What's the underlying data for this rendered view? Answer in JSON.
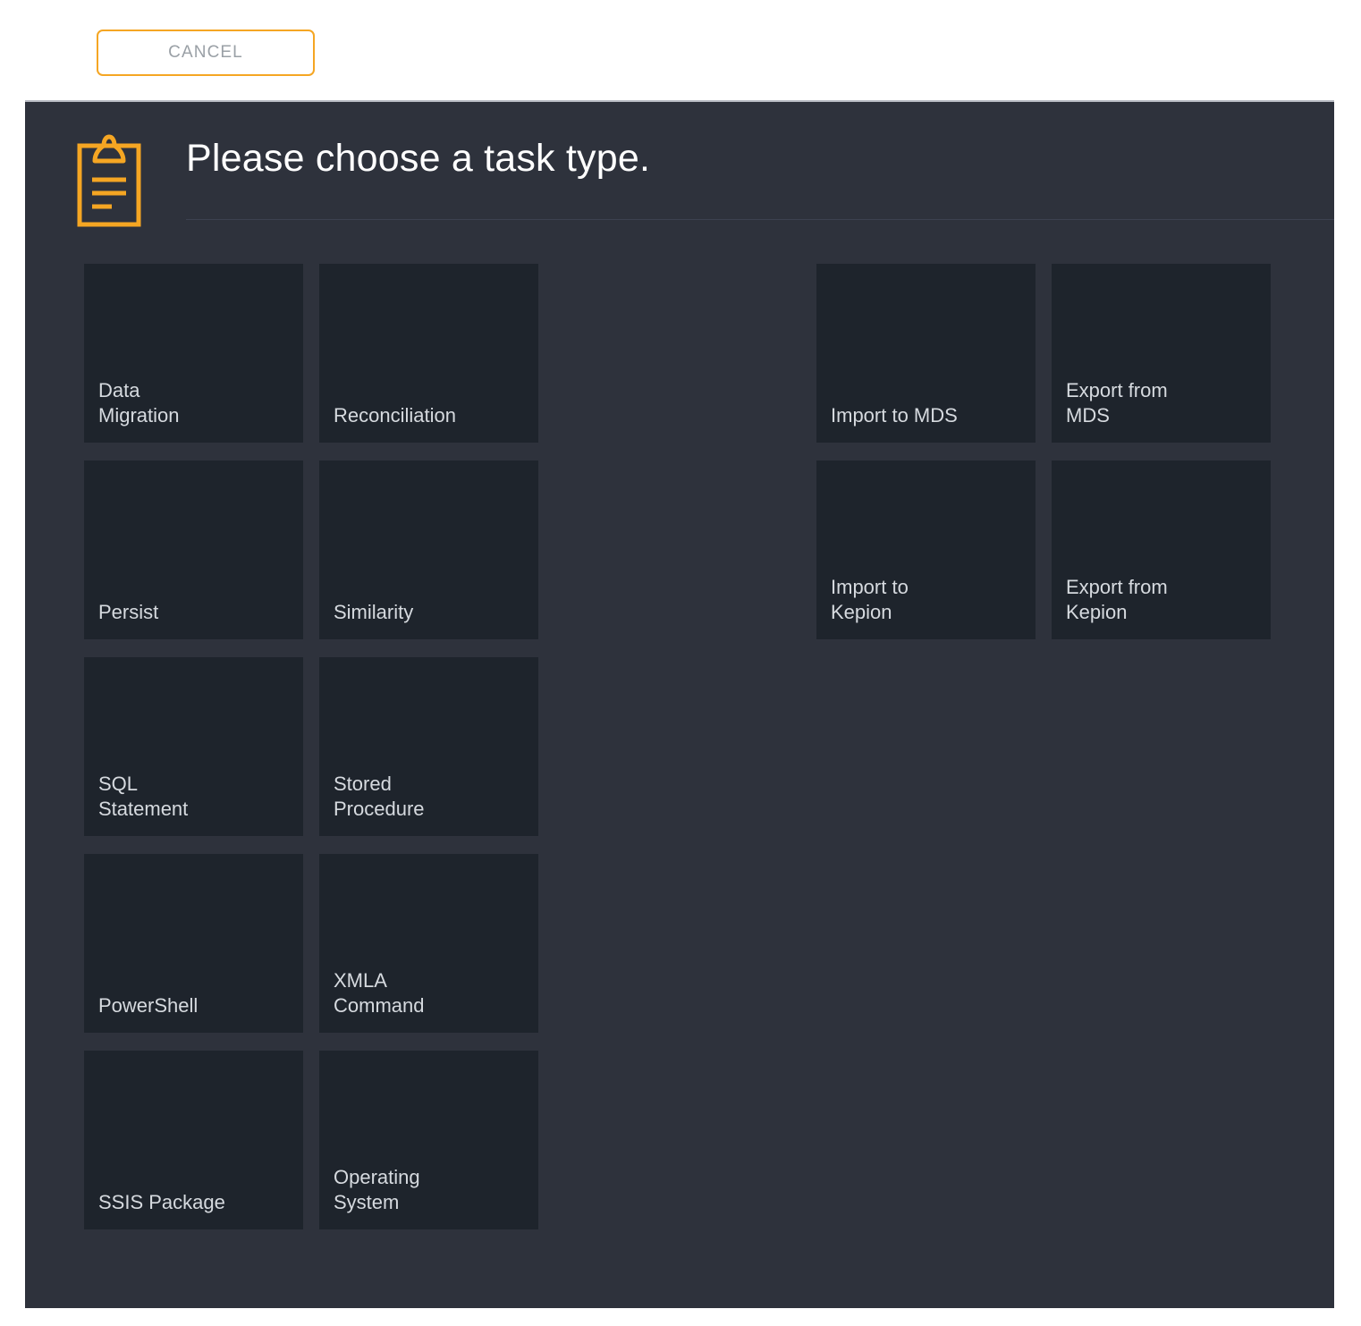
{
  "toolbar": {
    "cancel_label": "CANCEL"
  },
  "dialog": {
    "title": "Please choose a task type.",
    "icon": "clipboard-icon",
    "accent_color": "#F5A623",
    "panel_background": "#2E323C",
    "tile_background": "#1E242C",
    "tile_text_color": "#D6DADF",
    "title_color": "#FFFFFF"
  },
  "task_types": {
    "left_group": [
      {
        "label": "Data\nMigration"
      },
      {
        "label": "Reconciliation"
      },
      {
        "label": "Persist"
      },
      {
        "label": "Similarity"
      },
      {
        "label": "SQL\nStatement"
      },
      {
        "label": "Stored\nProcedure"
      },
      {
        "label": "PowerShell"
      },
      {
        "label": "XMLA\nCommand"
      },
      {
        "label": "SSIS Package"
      },
      {
        "label": "Operating\nSystem"
      }
    ],
    "right_group": [
      {
        "label": "Import to MDS"
      },
      {
        "label": "Export from\nMDS"
      },
      {
        "label": "Import to\nKepion"
      },
      {
        "label": "Export from\nKepion"
      }
    ]
  }
}
